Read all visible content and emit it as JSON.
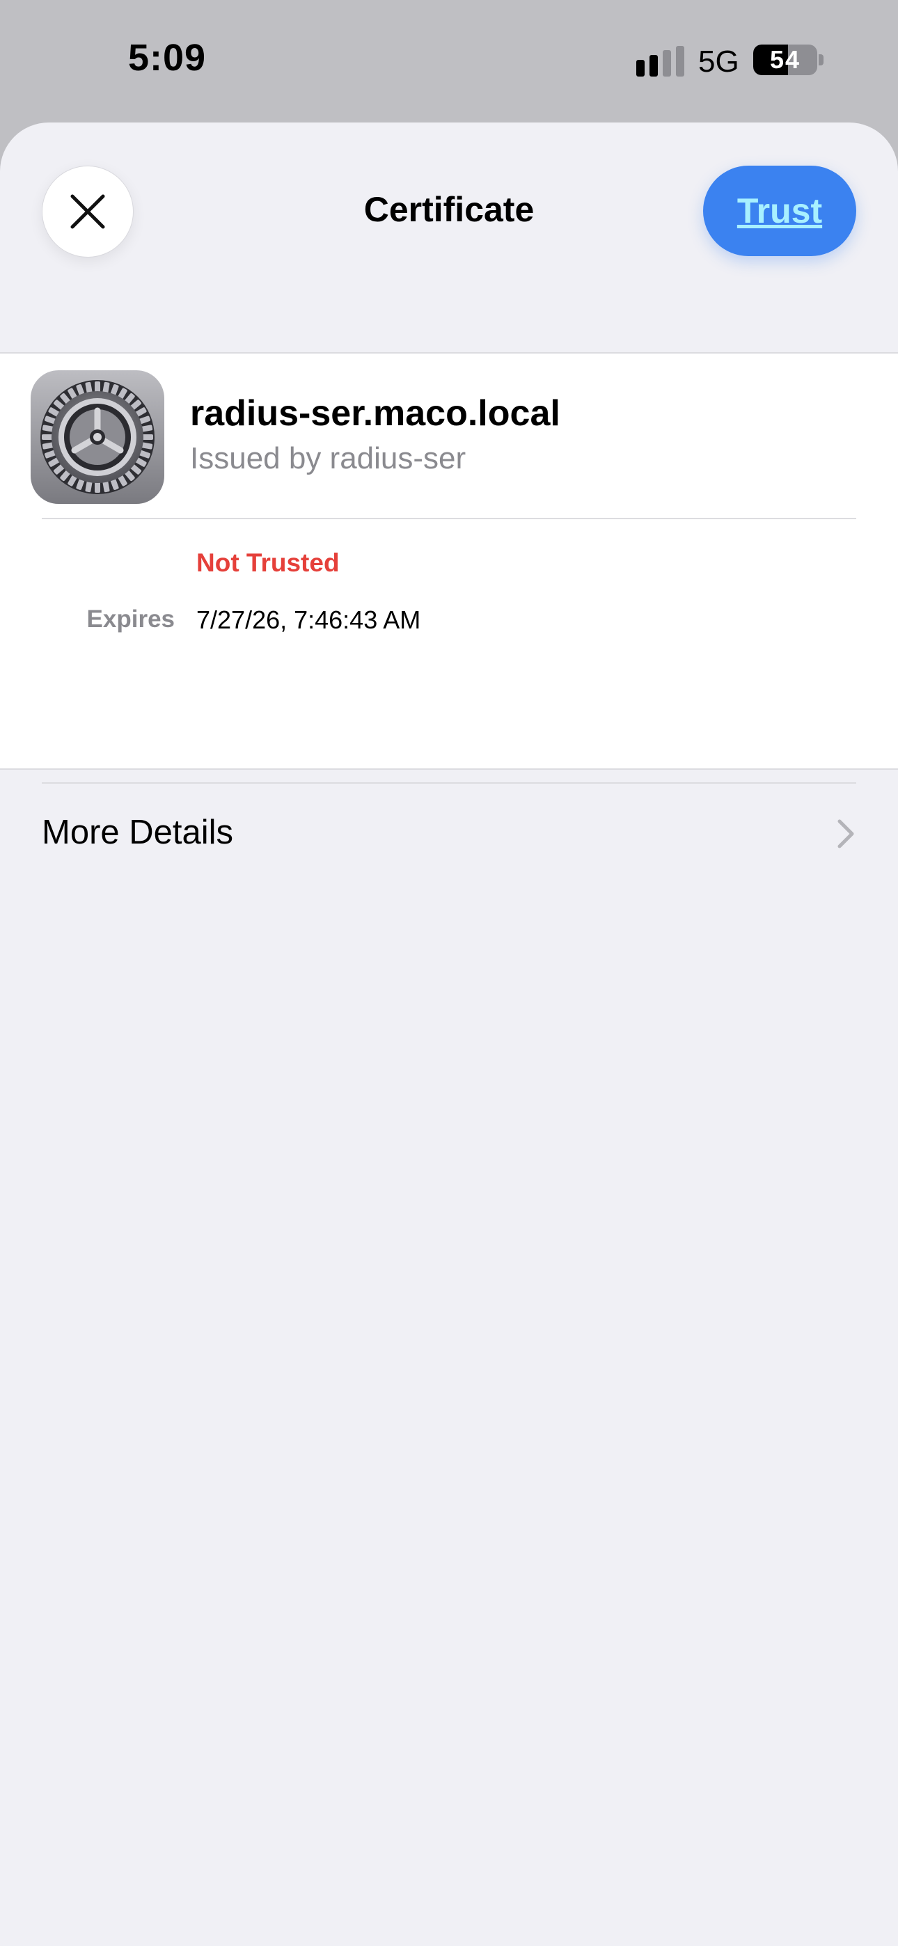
{
  "status_bar": {
    "time": "5:09",
    "network": "5G",
    "battery_level": "54",
    "battery_fraction": 0.54,
    "signal_icon": "cellular-signal-icon"
  },
  "sheet": {
    "title": "Certificate",
    "close_icon": "close-icon",
    "trust_label": "Trust"
  },
  "certificate": {
    "icon": "settings-gear-icon",
    "name": "radius-ser.maco.local",
    "issuer": "Issued by radius-ser",
    "status": "Not Trusted",
    "expires_label": "Expires",
    "expires_value": "7/27/26, 7:46:43 AM"
  },
  "more_details": {
    "label": "More Details",
    "chevron_icon": "chevron-right-icon"
  },
  "colors": {
    "accent": "#3b82f0",
    "trust_text": "#a8f0ff",
    "status_red": "#e5403a",
    "sheet_background": "#f0f0f5",
    "status_bar_background": "#bfbfc3"
  }
}
